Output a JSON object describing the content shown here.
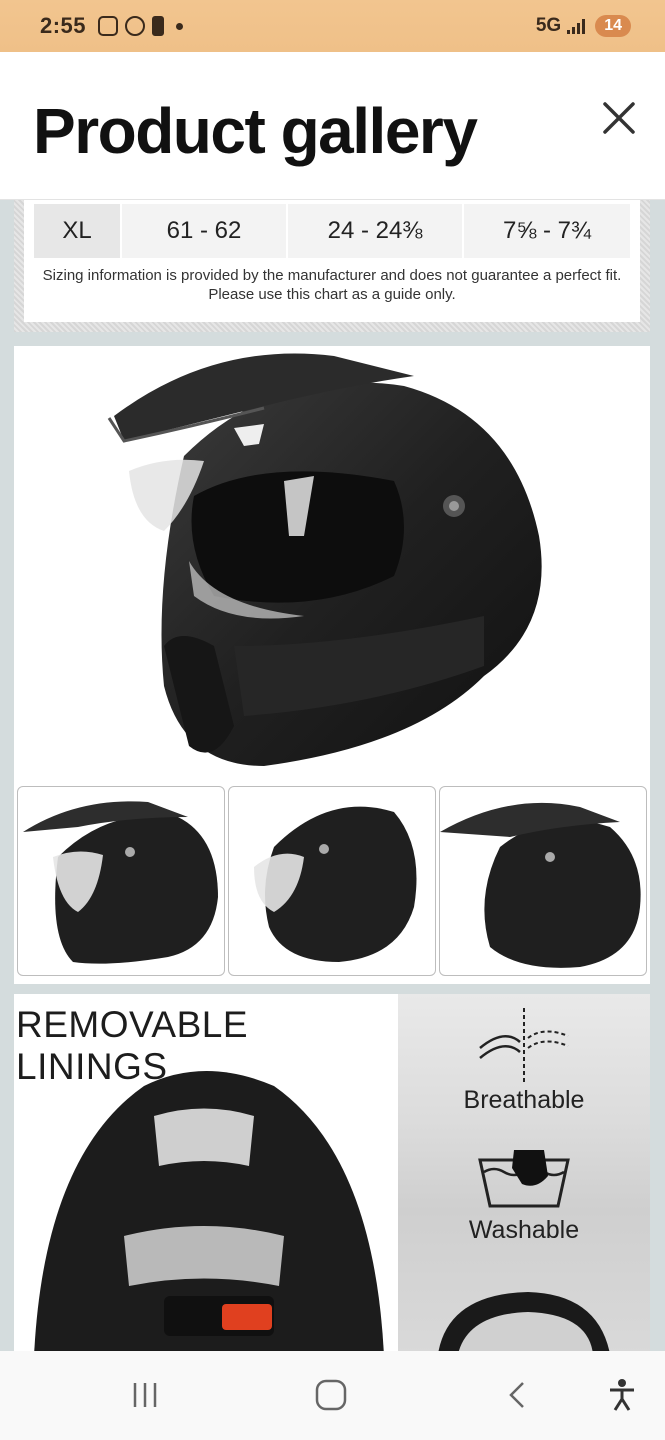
{
  "status_bar": {
    "time": "2:55",
    "network": "5G",
    "notification_count": "14"
  },
  "header": {
    "title": "Product gallery"
  },
  "size_chart": {
    "row": [
      "XL",
      "61 - 62",
      "24 - 24⅜",
      "7⅝ - 7¾"
    ],
    "note_line1": "Sizing information is provided by the manufacturer and does not guarantee a perfect fit.",
    "note_line2": "Please use this chart as a guide only."
  },
  "lining_panel": {
    "heading": "REMOVABLE LININGS",
    "features": [
      {
        "label": "Breathable",
        "icon": "breathable-icon"
      },
      {
        "label": "Washable",
        "icon": "washable-icon"
      }
    ]
  },
  "nav_bar": {
    "buttons": [
      "recent-apps-icon",
      "home-icon",
      "back-icon",
      "accessibility-icon"
    ]
  }
}
